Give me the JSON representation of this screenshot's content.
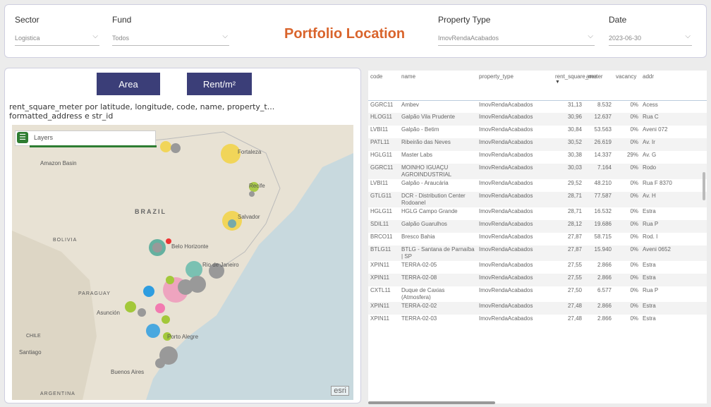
{
  "filters": [
    {
      "label": "Sector",
      "value": "Logistica"
    },
    {
      "label": "Fund",
      "value": "Todos"
    },
    {
      "label": "Property Type",
      "value": "ImovRendaAcabados"
    },
    {
      "label": "Date",
      "value": "2023-06-30"
    }
  ],
  "title": "Portfolio Location",
  "buttons": {
    "area": "Area",
    "rent": "Rent/m²"
  },
  "map": {
    "title": "rent_square_meter por latitude, longitude, code, name, property_t... formatted_address e str_id",
    "layers_label": "Layers",
    "esri": "esri",
    "labels": [
      "Amazon Basin",
      "BRAZIL",
      "BOLIVIA",
      "PARAGUAY",
      "São Paulo",
      "Rio de Janeiro",
      "Porto Alegre",
      "Buenos Aires",
      "ARGENTINA",
      "Belo Horizonte",
      "Salvador",
      "Recife",
      "Fortaleza",
      "Santiago",
      "Asunción",
      "CHILE"
    ]
  },
  "table": {
    "columns": [
      "code",
      "name",
      "property_type",
      "rent_square_meter",
      "area",
      "vacancy",
      "addr"
    ],
    "rows": [
      [
        "GGRC11",
        "Ambev",
        "ImovRendaAcabados",
        "31,13",
        "8.532",
        "0%",
        "Acess"
      ],
      [
        "HLOG11",
        "Galpão Vila Prudente",
        "ImovRendaAcabados",
        "30,96",
        "12.637",
        "0%",
        "Rua C"
      ],
      [
        "LVBI11",
        "Galpão - Betim",
        "ImovRendaAcabados",
        "30,84",
        "53.563",
        "0%",
        "Aveni 072"
      ],
      [
        "PATL11",
        "Ribeirão das Neves",
        "ImovRendaAcabados",
        "30,52",
        "26.619",
        "0%",
        "Av. Ir"
      ],
      [
        "HGLG11",
        "Master Labs",
        "ImovRendaAcabados",
        "30,38",
        "14.337",
        "29%",
        "Av. G"
      ],
      [
        "GGRC11",
        "MOINHO IGUAÇU AGROINDUSTRIAL",
        "ImovRendaAcabados",
        "30,03",
        "7.164",
        "0%",
        "Rodo"
      ],
      [
        "LVBI11",
        "Galpão - Araucária",
        "ImovRendaAcabados",
        "29,52",
        "48.210",
        "0%",
        "Rua F 8370"
      ],
      [
        "GTLG11",
        "DCR - Distribution Center Rodoanel",
        "ImovRendaAcabados",
        "28,71",
        "77.587",
        "0%",
        "Av. H"
      ],
      [
        "HGLG11",
        "HGLG Campo Grande",
        "ImovRendaAcabados",
        "28,71",
        "16.532",
        "0%",
        "Estra"
      ],
      [
        "SDIL11",
        "Galpão Guarulhos",
        "ImovRendaAcabados",
        "28,12",
        "19.686",
        "0%",
        "Rua P"
      ],
      [
        "BRCO11",
        "Bresco Bahia",
        "ImovRendaAcabados",
        "27,87",
        "58.715",
        "0%",
        "Rod. I"
      ],
      [
        "BTLG11",
        "BTLG - Santana de Parnaíba | SP",
        "ImovRendaAcabados",
        "27,87",
        "15.940",
        "0%",
        "Aveni 0652"
      ],
      [
        "XPIN11",
        "TERRA-02-05",
        "ImovRendaAcabados",
        "27,55",
        "2.866",
        "0%",
        "Estra"
      ],
      [
        "XPIN11",
        "TERRA-02-08",
        "ImovRendaAcabados",
        "27,55",
        "2.866",
        "0%",
        "Estra"
      ],
      [
        "CXTL11",
        "Duque de Caxias (Atmosfera)",
        "ImovRendaAcabados",
        "27,50",
        "6.577",
        "0%",
        "Rua P"
      ],
      [
        "XPIN11",
        "TERRA-02-02",
        "ImovRendaAcabados",
        "27,48",
        "2.866",
        "0%",
        "Estra"
      ],
      [
        "XPIN11",
        "TERRA-02-03",
        "ImovRendaAcabados",
        "27,48",
        "2.866",
        "0%",
        "Estra"
      ]
    ]
  },
  "colors": {
    "accent": "#d9642c",
    "button": "#3b3e78",
    "layers": "#2e7d32"
  }
}
